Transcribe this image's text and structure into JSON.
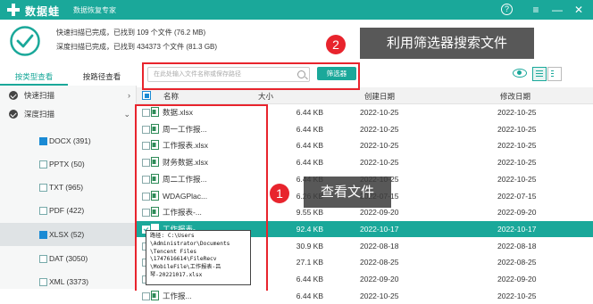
{
  "app": {
    "name": "数据蛙",
    "subtitle": "数据恢复专家",
    "help_label": "?",
    "menu_label": "≡",
    "minimize_label": "—",
    "close_label": "✕"
  },
  "status": {
    "line1": "快速扫描已完成，已找到 109 个文件 (76.2 MB)",
    "line2": "深度扫描已完成，已找到 434373 个文件 (81.3 GB)"
  },
  "sidebar": {
    "tabs": [
      {
        "label": "按类型查看",
        "active": true
      },
      {
        "label": "按路径查看",
        "active": false
      }
    ],
    "groups": [
      {
        "label": "快速扫描",
        "expanded": false
      },
      {
        "label": "深度扫描",
        "expanded": true
      }
    ],
    "items": [
      {
        "label": "DOCX (391)",
        "checked": true,
        "active": false
      },
      {
        "label": "PPTX (50)",
        "checked": false,
        "active": false
      },
      {
        "label": "TXT (965)",
        "checked": false,
        "active": false
      },
      {
        "label": "PDF (422)",
        "checked": false,
        "active": false
      },
      {
        "label": "XLSX (52)",
        "checked": true,
        "active": true
      },
      {
        "label": "DAT (3050)",
        "checked": false,
        "active": false
      },
      {
        "label": "XML (3373)",
        "checked": false,
        "active": false
      }
    ]
  },
  "toolbar": {
    "search_placeholder": "在此处输入文件名称或保存路径",
    "filter_label": "筛选器"
  },
  "table": {
    "headers": {
      "name": "名称",
      "size": "大小",
      "created": "创建日期",
      "modified": "修改日期"
    },
    "rows": [
      {
        "name": "数据.xlsx",
        "size": "6.44 KB",
        "created": "2022-10-25",
        "modified": "2022-10-25",
        "selected": false
      },
      {
        "name": "周一工作报...",
        "size": "6.44 KB",
        "created": "2022-10-25",
        "modified": "2022-10-25",
        "selected": false
      },
      {
        "name": "工作报表.xlsx",
        "size": "6.44 KB",
        "created": "2022-10-25",
        "modified": "2022-10-25",
        "selected": false
      },
      {
        "name": "财务数据.xlsx",
        "size": "6.44 KB",
        "created": "2022-10-25",
        "modified": "2022-10-25",
        "selected": false
      },
      {
        "name": "周二工作报...",
        "size": "6.44 KB",
        "created": "2022-10-25",
        "modified": "2022-10-25",
        "selected": false
      },
      {
        "name": "WDAGPlac...",
        "size": "6.26 KB",
        "created": "2022-07-15",
        "modified": "2022-07-15",
        "selected": false
      },
      {
        "name": "工作报表-...",
        "size": "9.55 KB",
        "created": "2022-09-20",
        "modified": "2022-09-20",
        "selected": false
      },
      {
        "name": "工作报表-...",
        "size": "92.4 KB",
        "created": "2022-10-17",
        "modified": "2022-10-17",
        "selected": true
      },
      {
        "name": "",
        "size": "30.9 KB",
        "created": "2022-08-18",
        "modified": "2022-08-18",
        "selected": false
      },
      {
        "name": "",
        "size": "27.1 KB",
        "created": "2022-08-25",
        "modified": "2022-08-25",
        "selected": false
      },
      {
        "name": "",
        "size": "6.44 KB",
        "created": "2022-09-20",
        "modified": "2022-09-20",
        "selected": false
      },
      {
        "name": "工作报...",
        "size": "6.44 KB",
        "created": "2022-10-25",
        "modified": "2022-10-25",
        "selected": false
      }
    ]
  },
  "tooltip": {
    "text": "路径: C:\\Users\n\\Administrator\\Documents\n\\Tencent Files\n\\1747616614\\FileRecv\n\\MobileFile\\工作报表-吕\n琴-20221017.xlsx"
  },
  "annotations": {
    "callout_2_number": "2",
    "callout_2_text": "利用筛选器搜索文件",
    "callout_1_number": "1",
    "callout_1_text": "查看文件"
  },
  "colors": {
    "accent": "#1aa89a",
    "highlight": "#e8242d",
    "checkbox": "#1a8ad4"
  }
}
